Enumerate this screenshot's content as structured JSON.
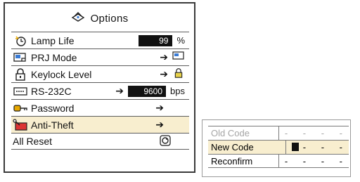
{
  "panel": {
    "title": "Options",
    "title_icon": "options-icon",
    "items": [
      {
        "label": "Lamp Life",
        "icon": "lamp-timer-icon",
        "value": "99",
        "unit": "%"
      },
      {
        "label": "PRJ Mode",
        "icon": "projector-mode-icon",
        "arrow": "➔"
      },
      {
        "label": "Keylock Level",
        "icon": "lock-icon",
        "arrow": "➔"
      },
      {
        "label": "RS-232C",
        "icon": "rs232-port-icon",
        "arrow": "➔",
        "value": "9600",
        "unit": "bps"
      },
      {
        "label": "Password",
        "icon": "key-icon",
        "arrow": "➔"
      },
      {
        "label": "Anti-Theft",
        "icon": "anti-theft-icon",
        "arrow": "➔"
      },
      {
        "label": "All Reset",
        "icon": "reset-icon"
      }
    ]
  },
  "code_panel": {
    "rows": [
      {
        "label": "Old Code",
        "value": "- - - -"
      },
      {
        "label": "New Code",
        "value": "- - -"
      },
      {
        "label": "Reconfirm",
        "value": "- - - -"
      }
    ]
  },
  "colors": {
    "selected_bg": "#f8eecf",
    "value_box": "#111111",
    "dim_text": "#a5a5a5"
  }
}
